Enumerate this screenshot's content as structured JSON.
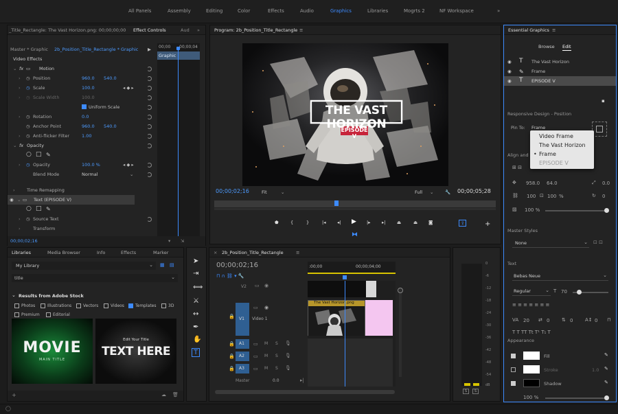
{
  "workspaces": [
    "All Panels",
    "Assembly",
    "Editing",
    "Color",
    "Effects",
    "Audio",
    "Graphics",
    "Libraries",
    "Mogrts 2",
    "NF Workspace"
  ],
  "active_workspace": "Graphics",
  "effect_controls": {
    "tab_source": "_Title_Rectangle: The Vast Horizon.png: 00;00;00;00",
    "tab_effect": "Effect Controls",
    "tab_audio": "Aud",
    "master_label": "Master * Graphic",
    "clip_label": "2b_Position_Title_Rectangle * Graphic",
    "timecode_start": "00;00",
    "timecode_end": "00;00;04",
    "graphic_clip_label": "Graphic",
    "video_effects": "Video Effects",
    "motion": "Motion",
    "position_label": "Position",
    "position_x": "960.0",
    "position_y": "540.0",
    "scale_label": "Scale",
    "scale_value": "100.0",
    "scale_width_label": "Scale Width",
    "scale_width_value": "100.0",
    "uniform_scale": "Uniform Scale",
    "rotation_label": "Rotation",
    "rotation_value": "0.0",
    "anchor_label": "Anchor Point",
    "anchor_x": "960.0",
    "anchor_y": "540.0",
    "antiflicker_label": "Anti-flicker Filter",
    "antiflicker_value": "1.00",
    "opacity_group": "Opacity",
    "opacity_label": "Opacity",
    "opacity_value": "100.0 %",
    "blend_label": "Blend Mode",
    "blend_value": "Normal",
    "time_remap": "Time Remapping",
    "text_layer": "Text (EPISODE V)",
    "source_text": "Source Text",
    "transform": "Transform",
    "bottom_timecode": "00;00;02;16"
  },
  "program": {
    "title": "Program: 2b_Position_Title_Rectangle",
    "video_title": "THE VAST HORIZON",
    "video_subtitle": "EPISODE V",
    "timecode": "00;00;02;16",
    "fit": "Fit",
    "full": "Full",
    "duration": "00;00;05;28"
  },
  "essential_graphics": {
    "title": "Essential Graphics",
    "tab_browse": "Browse",
    "tab_edit": "Edit",
    "layers": [
      "The Vast Horizon",
      "Frame",
      "EPISODE V"
    ],
    "responsive_label": "Responsive Design - Position",
    "pin_to_label": "Pin To:",
    "pin_to_value": "Frame",
    "pin_options": [
      "Video Frame",
      "The Vast Horizon",
      "Frame",
      "EPISODE V"
    ],
    "align_label": "Align and",
    "pos_x": "958.0",
    "pos_y": "64.0",
    "rot_value": "0.0",
    "scale_x": "100",
    "scale_y": "100",
    "scale_unit": "%",
    "rotation_value": "0",
    "opacity_value": "100 %",
    "master_styles_label": "Master Styles",
    "master_styles_value": "None",
    "text_label": "Text",
    "font_value": "Bebas Neue",
    "weight_value": "Regular",
    "size_value": "70",
    "tracking_value": "20",
    "leading_value": "0",
    "kerning_value": "0",
    "baseline_value": "0",
    "appearance_label": "Appearance",
    "fill_label": "Fill",
    "stroke_label": "Stroke",
    "stroke_value": "1.0",
    "shadow_label": "Shadow",
    "bottom_value": "100 %"
  },
  "libraries": {
    "tab_libraries": "Libraries",
    "tab_media": "Media Browser",
    "tab_info": "Info",
    "tab_effects": "Effects",
    "tab_markers": "Marker",
    "library_value": "My Library",
    "search_value": "title",
    "stock_header": "Results from Adobe Stock",
    "filters": [
      "Photos",
      "Illustrations",
      "Vectors",
      "Videos",
      "Templates",
      "3D",
      "Premium",
      "Editorial"
    ],
    "filters_checked": [
      "Templates"
    ],
    "thumb1_title": "MOVIE",
    "thumb1_sub": "MAIN TITLE",
    "thumb2_small": "Edit Your Title",
    "thumb2_title": "TEXT HERE"
  },
  "timeline": {
    "title": "2b_Position_Title_Rectangle",
    "timecode": "00;00;02;16",
    "ruler_start": ":00;00",
    "ruler_mid": "00;00;04;00",
    "v2": "V2",
    "v1": "V1",
    "video1": "Video 1",
    "a1": "A1",
    "a2": "A2",
    "a3": "A3",
    "master": "Master",
    "master_value": "0.0",
    "clip_label": "The Vast Horizon.png"
  },
  "meter": {
    "scale": [
      "0",
      "-6",
      "-12",
      "-18",
      "-24",
      "-30",
      "-36",
      "-42",
      "-48",
      "-54",
      "dB"
    ],
    "footer": [
      "S",
      "S"
    ]
  },
  "colors": {
    "accent": "#3d8bff",
    "panel": "#232323",
    "pink_clip": "#f4c6f0",
    "timeline_blue": "#2f5f92"
  }
}
